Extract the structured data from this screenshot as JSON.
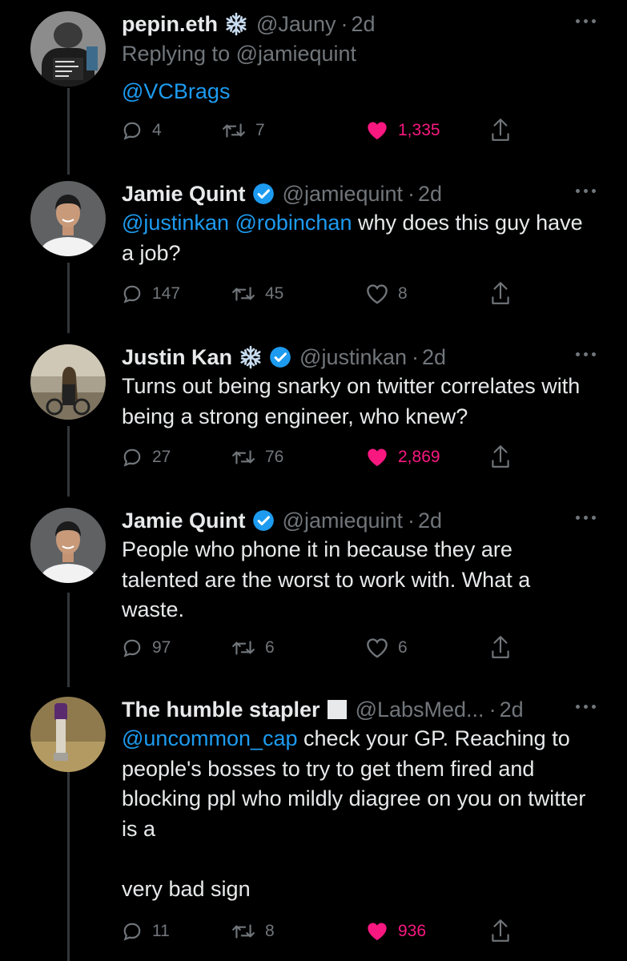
{
  "tweets": [
    {
      "name": "pepin.eth",
      "handle": "@Jauny",
      "time": "2d",
      "replying_to": "Replying to @jamiequint",
      "body_link": "@VCBrags",
      "body_text": "",
      "replies": "4",
      "retweets": "7",
      "likes": "1,335",
      "liked": true,
      "badges": [
        "snowflake-icon"
      ]
    },
    {
      "name": "Jamie Quint",
      "handle": "@jamiequint",
      "time": "2d",
      "body_link": "@justinkan @robinchan",
      "body_text": " why does this guy have a job?",
      "replies": "147",
      "retweets": "45",
      "likes": "8",
      "liked": false,
      "badges": [
        "verified-icon"
      ]
    },
    {
      "name": "Justin Kan",
      "handle": "@justinkan",
      "time": "2d",
      "body_link": "",
      "body_text": "Turns out being snarky on twitter correlates with being a strong engineer, who knew?",
      "replies": "27",
      "retweets": "76",
      "likes": "2,869",
      "liked": true,
      "badges": [
        "snowflake-icon",
        "verified-icon"
      ]
    },
    {
      "name": "Jamie Quint",
      "handle": "@jamiequint",
      "time": "2d",
      "body_link": "",
      "body_text": "People who phone it in because they are talented are the worst to work with. What a waste.",
      "replies": "97",
      "retweets": "6",
      "likes": "6",
      "liked": false,
      "badges": [
        "verified-icon"
      ]
    },
    {
      "name": "The humble stapler",
      "handle": "@LabsMed...",
      "time": "2d",
      "body_link": "@uncommon_cap",
      "body_text": " check your GP. Reaching to people's bosses to try to get them fired and blocking ppl who mildly diagree on you on twitter is a\n\nvery bad sign",
      "replies": "11",
      "retweets": "8",
      "likes": "936",
      "liked": true,
      "badges": [
        "white-square-icon"
      ]
    }
  ],
  "separator": "·",
  "colors": {
    "background": "#000000",
    "text": "#e7e9ea",
    "muted": "#71767b",
    "link": "#1d9bf0",
    "like": "#f91880",
    "verified": "#1d9bf0"
  }
}
